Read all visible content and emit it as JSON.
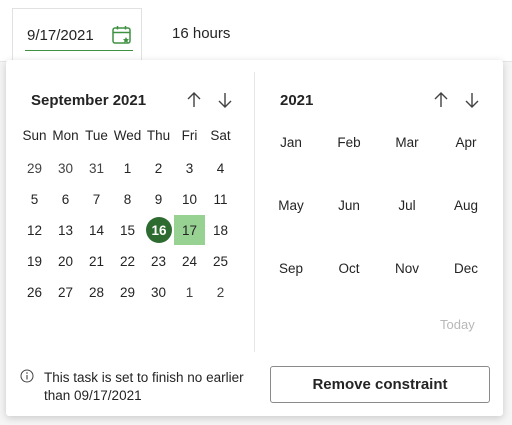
{
  "field": {
    "date_value": "9/17/2021",
    "duration": "16 hours"
  },
  "day_picker": {
    "title": "September 2021",
    "weekdays": [
      "Sun",
      "Mon",
      "Tue",
      "Wed",
      "Thu",
      "Fri",
      "Sat"
    ],
    "weeks": [
      [
        "29",
        "30",
        "31",
        "1",
        "2",
        "3",
        "4"
      ],
      [
        "5",
        "6",
        "7",
        "8",
        "9",
        "10",
        "11"
      ],
      [
        "12",
        "13",
        "14",
        "15",
        "16",
        "17",
        "18"
      ],
      [
        "19",
        "20",
        "21",
        "22",
        "23",
        "24",
        "25"
      ],
      [
        "26",
        "27",
        "28",
        "29",
        "30",
        "1",
        "2"
      ]
    ],
    "today_day": "16",
    "selected_day": "17"
  },
  "month_picker": {
    "year": "2021",
    "months": [
      "Jan",
      "Feb",
      "Mar",
      "Apr",
      "May",
      "Jun",
      "Jul",
      "Aug",
      "Sep",
      "Oct",
      "Nov",
      "Dec"
    ],
    "today_label": "Today"
  },
  "footer": {
    "info_text": "This task is set to finish no earlier than 09/17/2021",
    "remove_button": "Remove constraint"
  },
  "colors": {
    "accent_dark": "#2e6b30",
    "accent_light": "#97d293"
  },
  "icons": {
    "date_field": "calendar-icon",
    "prev": "arrow-up-icon",
    "next": "arrow-down-icon",
    "info": "info-icon"
  }
}
